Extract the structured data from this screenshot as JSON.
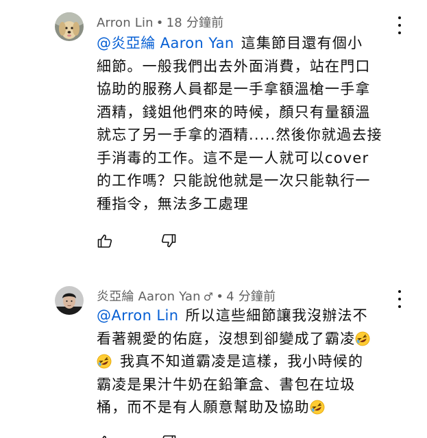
{
  "comments": [
    {
      "author": "Arron Lin",
      "separator": "•",
      "timestamp": "18 分鐘前",
      "mention": "@炎亞綸 Aaron Yan",
      "lines": [
        "這集節目還有個小",
        "細節。一般我們出去外面消費，站在門口",
        "協助的服務人員都是一手拿額溫槍一手拿",
        "酒精，錢姐他們來的時候，顏只有量額溫",
        "就忘了另一手拿的酒精.....然後你就過去接",
        "手消毒的工作。這不是一人就可以cover",
        "的工作嗎？只能說他就是一次只能執行一",
        "種指令，無法多工處理"
      ],
      "like_icon": "thumbs-up-icon",
      "dislike_icon": "thumbs-down-icon"
    },
    {
      "author": "炎亞綸 Aaron Yan",
      "owner_icon": "♂",
      "separator": "•",
      "timestamp": "4 分鐘前",
      "mention": "@Arron Lin",
      "line1": "所以這些細節讓我沒辦法不",
      "line2": "看著親愛的佑庭，沒想到卻變成了霸凌",
      "line3": "我真不知道霸凌是這樣，我小時候的",
      "line4": "霸凌是果汁牛奶在鉛筆盒、書包在垃圾",
      "line5": "桶，而不是有人願意幫助及協助",
      "emoji_icon": "rolling-on-floor-laughing-emoji"
    }
  ],
  "colors": {
    "text": "#0f0f0f",
    "meta": "#606060",
    "mention": "#065fd4"
  }
}
